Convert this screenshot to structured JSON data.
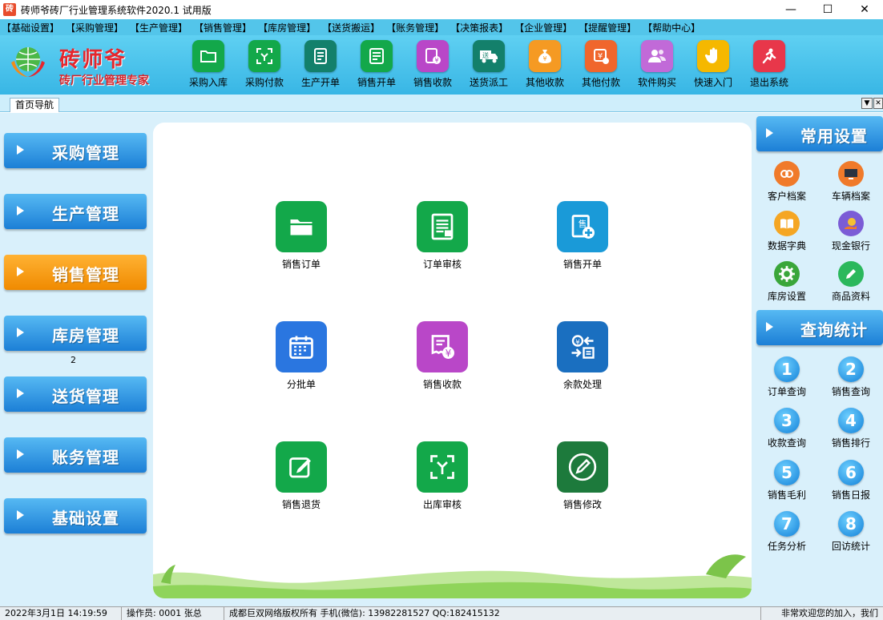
{
  "window": {
    "title": "砖师爷砖厂行业管理系统软件2020.1 试用版",
    "app_icon_text": "砖",
    "minimize": "—",
    "maximize": "☐",
    "close": "✕"
  },
  "menu": [
    "【基础设置】",
    "【采购管理】",
    "【生产管理】",
    "【销售管理】",
    "【库房管理】",
    "【送货搬运】",
    "【账务管理】",
    "【决策报表】",
    "【企业管理】",
    "【提醒管理】",
    "【帮助中心】"
  ],
  "logo": {
    "name": "砖师爷",
    "slogan": "砖厂行业管理专家"
  },
  "toolbar": [
    {
      "label": "采购入库",
      "icon": "folder-icon",
      "color": "#13a84a"
    },
    {
      "label": "采购付款",
      "icon": "scan-payment-icon",
      "color": "#13a84a"
    },
    {
      "label": "生产开单",
      "icon": "production-doc-icon",
      "color": "#13806b"
    },
    {
      "label": "销售开单",
      "icon": "sales-doc-icon",
      "color": "#13a84a"
    },
    {
      "label": "销售收款",
      "icon": "receipt-yen-icon",
      "color": "#b947c8"
    },
    {
      "label": "送货派工",
      "icon": "delivery-truck-icon",
      "color": "#13806b"
    },
    {
      "label": "其他收款",
      "icon": "money-bag-icon",
      "color": "#f59a23"
    },
    {
      "label": "其他付款",
      "icon": "yen-payment-icon",
      "color": "#f0662c"
    },
    {
      "label": "软件购买",
      "icon": "users-icon",
      "color": "#c16ad8"
    },
    {
      "label": "快速入门",
      "icon": "hand-icon",
      "color": "#f5b800"
    },
    {
      "label": "退出系统",
      "icon": "exit-icon",
      "color": "#e8374a"
    }
  ],
  "tabs": {
    "home": "首页导航",
    "dropdown": "▼",
    "close": "✕"
  },
  "left_nav": {
    "items": [
      {
        "label": "采购管理",
        "active": false
      },
      {
        "label": "生产管理",
        "active": false
      },
      {
        "label": "销售管理",
        "active": true
      },
      {
        "label": "库房管理",
        "active": false
      },
      {
        "label": "送货管理",
        "active": false
      },
      {
        "label": "账务管理",
        "active": false
      },
      {
        "label": "基础设置",
        "active": false
      }
    ],
    "note": "2"
  },
  "panel": {
    "items": [
      {
        "label": "销售订单",
        "icon": "folder-icon",
        "color": "#13a84a"
      },
      {
        "label": "订单审核",
        "icon": "order-review-icon",
        "color": "#13a84a"
      },
      {
        "label": "销售开单",
        "icon": "sales-invoice-icon",
        "color": "#1a9ad8"
      },
      {
        "label": "分批单",
        "icon": "calendar-icon",
        "color": "#2a76e0"
      },
      {
        "label": "销售收款",
        "icon": "receipt-yen-icon",
        "color": "#b947c8"
      },
      {
        "label": "余款处理",
        "icon": "balance-exchange-icon",
        "color": "#1a6fc0"
      },
      {
        "label": "销售退货",
        "icon": "edit-icon",
        "color": "#13a84a"
      },
      {
        "label": "出库审核",
        "icon": "scan-outbound-icon",
        "color": "#13a84a"
      },
      {
        "label": "销售修改",
        "icon": "pen-circle-icon",
        "color": "#1d7a3c"
      }
    ]
  },
  "right_nav": {
    "settings_title": "常用设置",
    "settings": [
      {
        "label": "客户档案",
        "icon": "customer-link-icon",
        "color": "#f07a2a"
      },
      {
        "label": "车辆档案",
        "icon": "monitor-icon",
        "color": "#f07a2a"
      },
      {
        "label": "数据字典",
        "icon": "book-icon",
        "color": "#f5a623"
      },
      {
        "label": "现金银行",
        "icon": "cash-bank-icon",
        "color": "#7b5cd6"
      },
      {
        "label": "库房设置",
        "icon": "gear-icon",
        "color": "#3aa63a"
      },
      {
        "label": "商品资料",
        "icon": "pencil-icon",
        "color": "#2bb85c"
      }
    ],
    "query_title": "查询统计",
    "queries": [
      {
        "num": "1",
        "label": "订单查询"
      },
      {
        "num": "2",
        "label": "销售查询"
      },
      {
        "num": "3",
        "label": "收款查询"
      },
      {
        "num": "4",
        "label": "销售排行"
      },
      {
        "num": "5",
        "label": "销售毛利"
      },
      {
        "num": "6",
        "label": "销售日报"
      },
      {
        "num": "7",
        "label": "任务分析"
      },
      {
        "num": "8",
        "label": "回访统计"
      }
    ]
  },
  "status": {
    "datetime": "2022年3月1日 14:19:59",
    "operator": "操作员: 0001 张总",
    "copyright": "成都巨双网络版权所有 手机(微信): 13982281527 QQ:182415132",
    "welcome": "非常欢迎您的加入，我们"
  }
}
